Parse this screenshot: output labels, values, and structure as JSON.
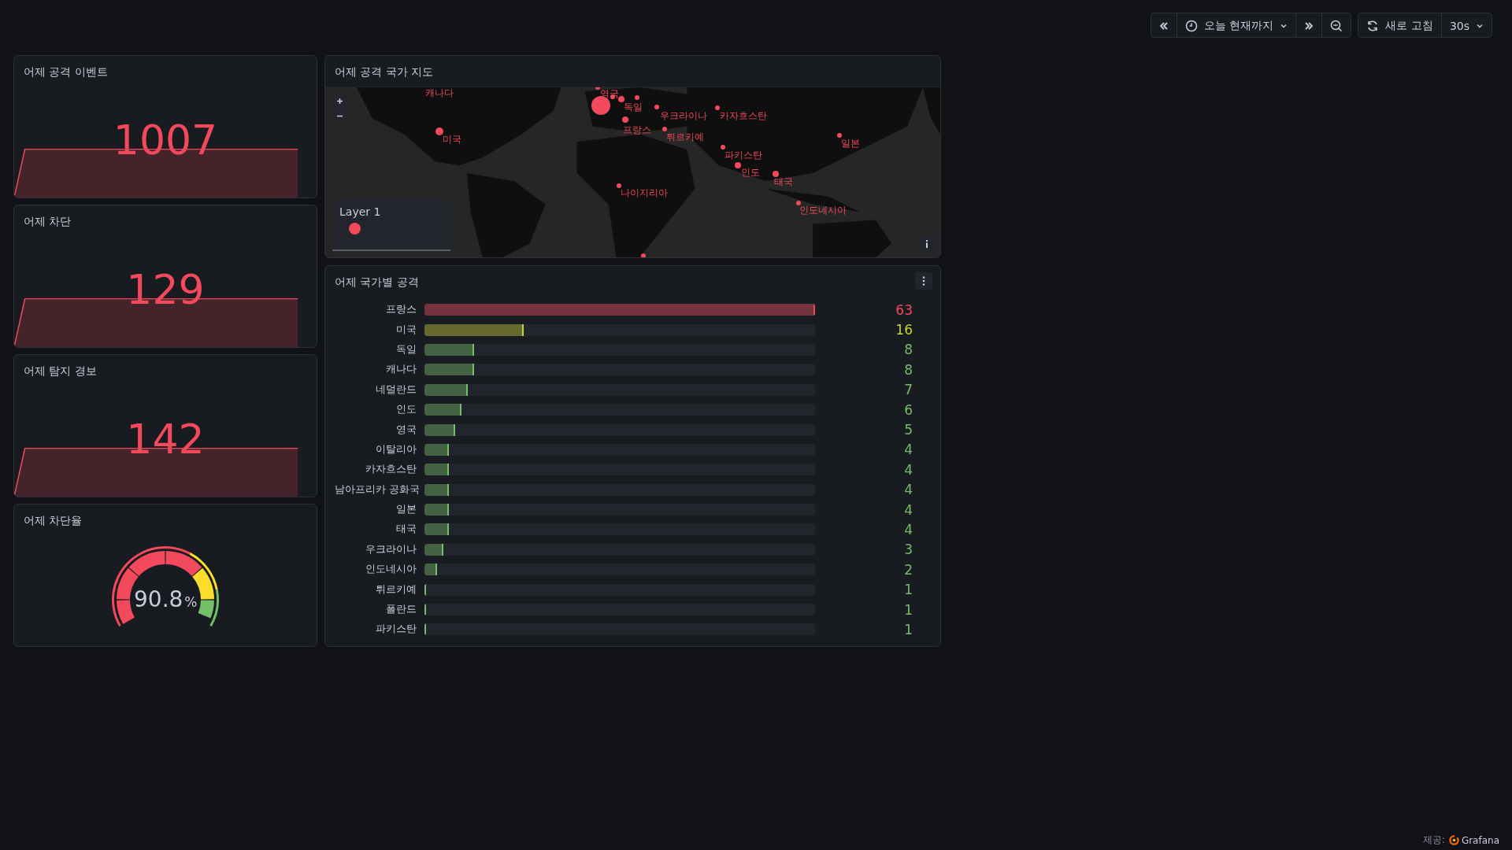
{
  "toolbar": {
    "time_picker": {
      "label": "오늘 현재까지"
    },
    "refresh": {
      "label": "새로 고침"
    },
    "interval": {
      "label": "30s"
    }
  },
  "stats": [
    {
      "title": "어제 공격 이벤트",
      "value": "1007"
    },
    {
      "title": "어제 차단",
      "value": "129"
    },
    {
      "title": "어제 탐지 경보",
      "value": "142"
    }
  ],
  "gauge": {
    "title": "어제 차단율",
    "value": "90.8",
    "unit": "%"
  },
  "map": {
    "title": "어제 공격 국가 지도",
    "legend": {
      "label": "Layer 1"
    },
    "markers": [
      {
        "label": "캐나다"
      },
      {
        "label": "미국"
      },
      {
        "label": "영국"
      },
      {
        "label": "독일"
      },
      {
        "label": "프랑스"
      },
      {
        "label": "우크라이나"
      },
      {
        "label": "카자흐스탄"
      },
      {
        "label": "튀르키예"
      },
      {
        "label": "파키스탄"
      },
      {
        "label": "인도"
      },
      {
        "label": "태국"
      },
      {
        "label": "인도네시아"
      },
      {
        "label": "일본"
      },
      {
        "label": "나이지리아"
      }
    ]
  },
  "bars": {
    "title": "어제 국가별 공격",
    "rows": [
      {
        "label": "프랑스",
        "value": "63",
        "level": 1,
        "color": "#f2495c"
      },
      {
        "label": "미국",
        "value": "16",
        "level": 0.254,
        "color": "#c8d33a"
      },
      {
        "label": "독일",
        "value": "8",
        "level": 0.127,
        "color": "#73bf69"
      },
      {
        "label": "캐나다",
        "value": "8",
        "level": 0.127,
        "color": "#73bf69"
      },
      {
        "label": "네덜란드",
        "value": "7",
        "level": 0.111,
        "color": "#73bf69"
      },
      {
        "label": "인도",
        "value": "6",
        "level": 0.095,
        "color": "#73bf69"
      },
      {
        "label": "영국",
        "value": "5",
        "level": 0.079,
        "color": "#73bf69"
      },
      {
        "label": "이탈리아",
        "value": "4",
        "level": 0.063,
        "color": "#73bf69"
      },
      {
        "label": "카자흐스탄",
        "value": "4",
        "level": 0.063,
        "color": "#73bf69"
      },
      {
        "label": "남아프리카 공화국",
        "value": "4",
        "level": 0.063,
        "color": "#73bf69"
      },
      {
        "label": "일본",
        "value": "4",
        "level": 0.063,
        "color": "#73bf69"
      },
      {
        "label": "태국",
        "value": "4",
        "level": 0.063,
        "color": "#73bf69"
      },
      {
        "label": "우크라이나",
        "value": "3",
        "level": 0.048,
        "color": "#73bf69"
      },
      {
        "label": "인도네시아",
        "value": "2",
        "level": 0.032,
        "color": "#73bf69"
      },
      {
        "label": "튀르키예",
        "value": "1",
        "level": 0.004,
        "color": "#73bf69"
      },
      {
        "label": "폴란드",
        "value": "1",
        "level": 0.004,
        "color": "#73bf69"
      },
      {
        "label": "파키스탄",
        "value": "1",
        "level": 0.004,
        "color": "#73bf69"
      }
    ]
  },
  "footer": {
    "prefix": "제공:",
    "brand": "Grafana"
  }
}
